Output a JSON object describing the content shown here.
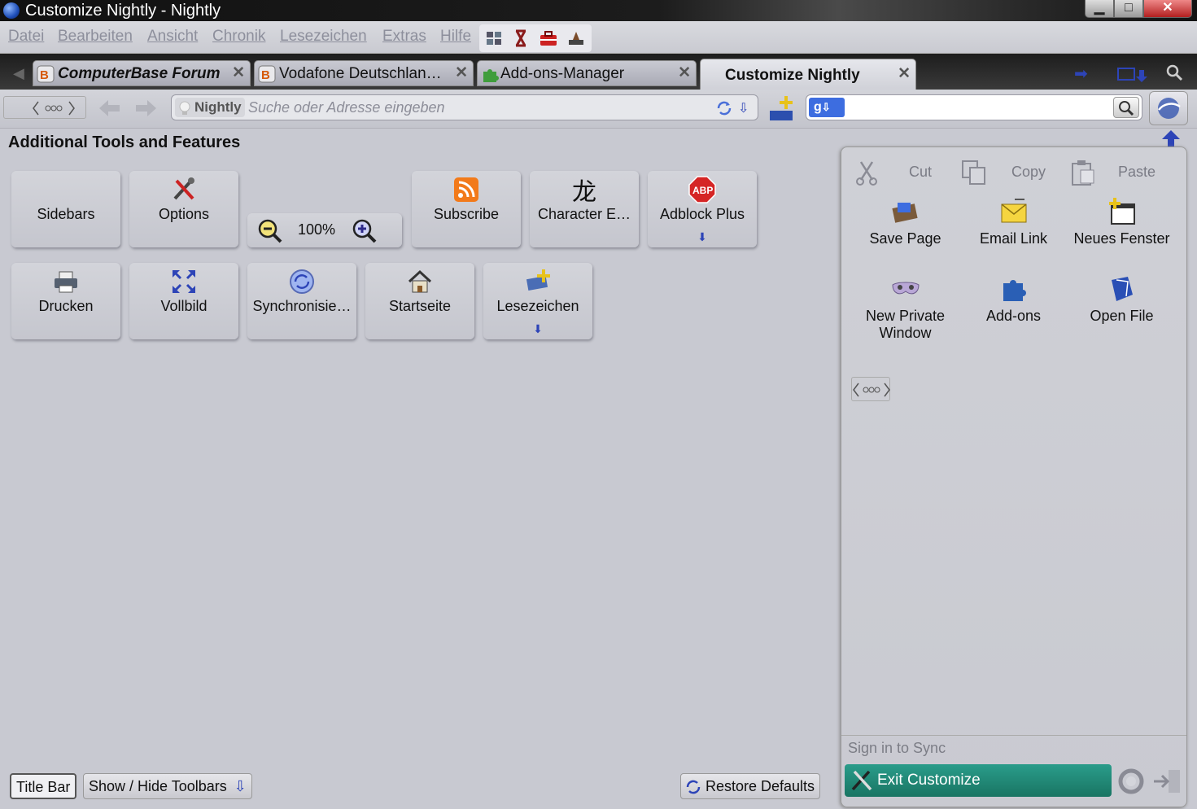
{
  "window": {
    "title": "Customize Nightly - Nightly"
  },
  "menubar": {
    "items": [
      "Datei",
      "Bearbeiten",
      "Ansicht",
      "Chronik",
      "Lesezeichen",
      "Extras",
      "Hilfe"
    ]
  },
  "tabs": [
    {
      "label": "ComputerBase Forum",
      "icon": "computerbase-icon"
    },
    {
      "label": "Vodafone Deutschlan…",
      "icon": "computerbase-icon"
    },
    {
      "label": "Add-ons-Manager",
      "icon": "puzzle-icon"
    },
    {
      "label": "Customize Nightly",
      "icon": "none",
      "active": true
    }
  ],
  "navbar": {
    "identity": "Nightly",
    "url_placeholder": "Suche oder Adresse eingeben",
    "search_value": ""
  },
  "palette": {
    "title": "Additional Tools and Features",
    "row1": [
      "Sidebars",
      "Options",
      "Subscribe",
      "Character E…",
      "Adblock Plus"
    ],
    "zoom": "100%",
    "row2": [
      "Drucken",
      "Vollbild",
      "Synchronisie…",
      "Startseite",
      "Lesezeichen"
    ]
  },
  "panel": {
    "edit": {
      "cut": "Cut",
      "copy": "Copy",
      "paste": "Paste"
    },
    "items": [
      "Save Page",
      "Email Link",
      "Neues Fenster",
      "New Private Window",
      "Add-ons",
      "Open File"
    ],
    "signin": "Sign in to Sync",
    "exit": "Exit Customize"
  },
  "bottom": {
    "titlebar": "Title Bar",
    "toolbars": "Show / Hide Toolbars",
    "restore": "Restore Defaults"
  },
  "colors": {
    "accent": "#197563",
    "background": "#c8c9d1",
    "link_blue": "#2d44b7"
  }
}
